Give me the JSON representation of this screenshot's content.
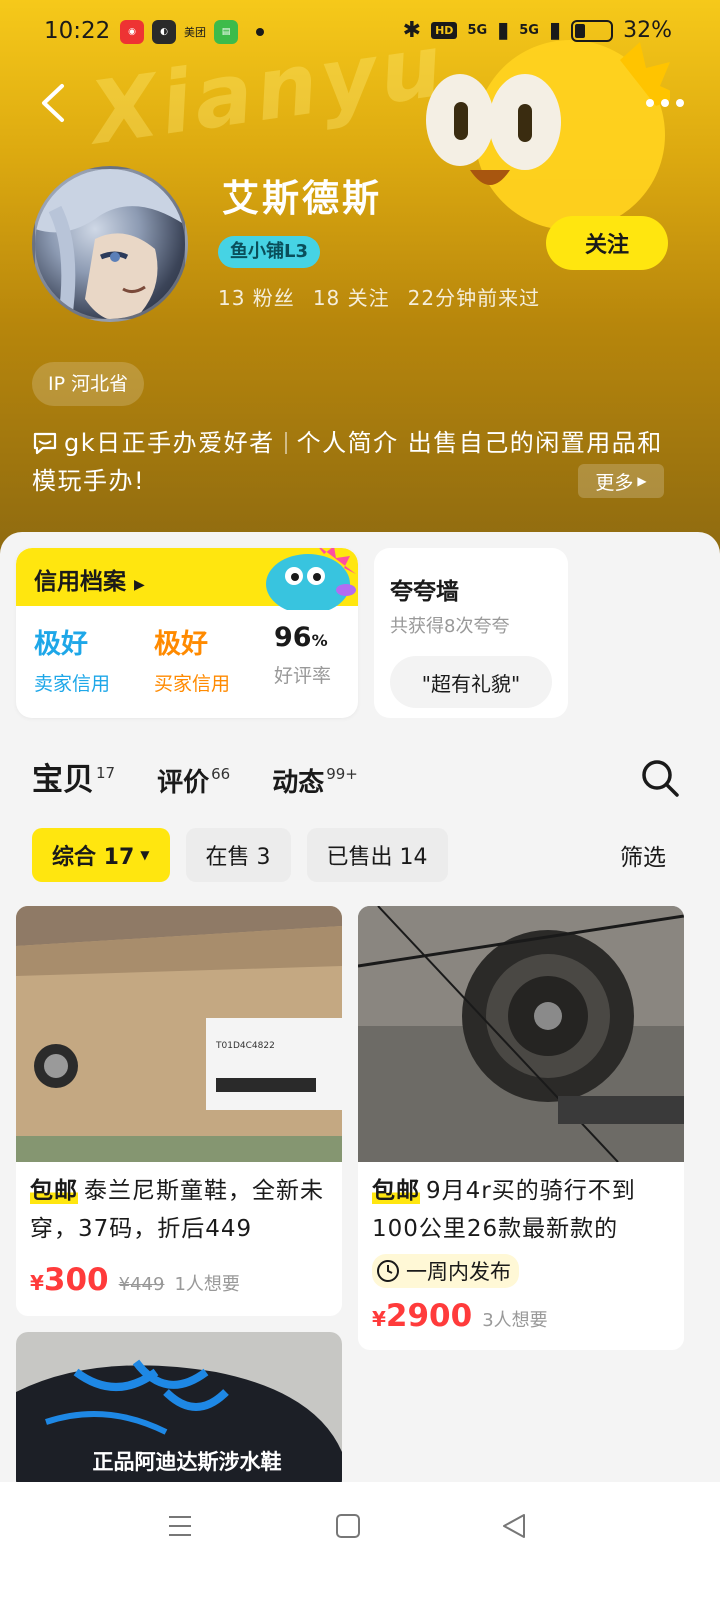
{
  "status_bar": {
    "time": "10:22",
    "apps": [
      "app-a",
      "wechat",
      "美团",
      "messages"
    ],
    "network_1": "5G",
    "network_2": "5G",
    "hd": "HD",
    "battery": "32%"
  },
  "profile": {
    "nickname": "艾斯德斯",
    "level": "鱼小铺L3",
    "fans": "13 粉丝",
    "following": "18 关注",
    "last_seen": "22分钟前来过",
    "follow_label": "关注",
    "ip": "IP 河北省",
    "bio_part1": "gk日正手办爱好者",
    "bio_part2": "个人简介 出售自己的闲置用品和模玩手办!",
    "more_label": "更多"
  },
  "credit": {
    "title": "信用档案",
    "seller_value": "极好",
    "seller_label": "卖家信用",
    "buyer_value": "极好",
    "buyer_label": "买家信用",
    "rate_value": "96",
    "rate_unit": "%",
    "rate_label": "好评率"
  },
  "praise": {
    "title": "夸夸墙",
    "subtitle": "共获得8次夸夸",
    "tag": "\"超有礼貌\""
  },
  "tabs": [
    {
      "label": "宝贝",
      "count": "17"
    },
    {
      "label": "评价",
      "count": "66"
    },
    {
      "label": "动态",
      "count": "99+"
    }
  ],
  "filters": [
    {
      "label": "综合 17"
    },
    {
      "label": "在售 3"
    },
    {
      "label": "已售出 14"
    }
  ],
  "filter_button": "筛选",
  "products": [
    {
      "tag": "包邮",
      "title": "泰兰尼斯童鞋，全新未穿，37码，折后449",
      "price_symbol": "¥",
      "price": "300",
      "original_price": "¥449",
      "wants": "1人想要",
      "box_label": "T01D4C4822"
    },
    {
      "tag": "包邮",
      "title": "9月4r买的骑行不到100公里26款最新款的",
      "badge": "一周内发布",
      "price_symbol": "¥",
      "price": "2900",
      "wants": "3人想要"
    },
    {
      "overlay": "正品阿迪达斯涉水鞋"
    }
  ],
  "colors": {
    "accent": "#ffe60f",
    "price": "#ff3b3b",
    "seller_credit": "#1ea7e8",
    "buyer_credit": "#ff8a00",
    "level_badge": "#46d3e4"
  }
}
